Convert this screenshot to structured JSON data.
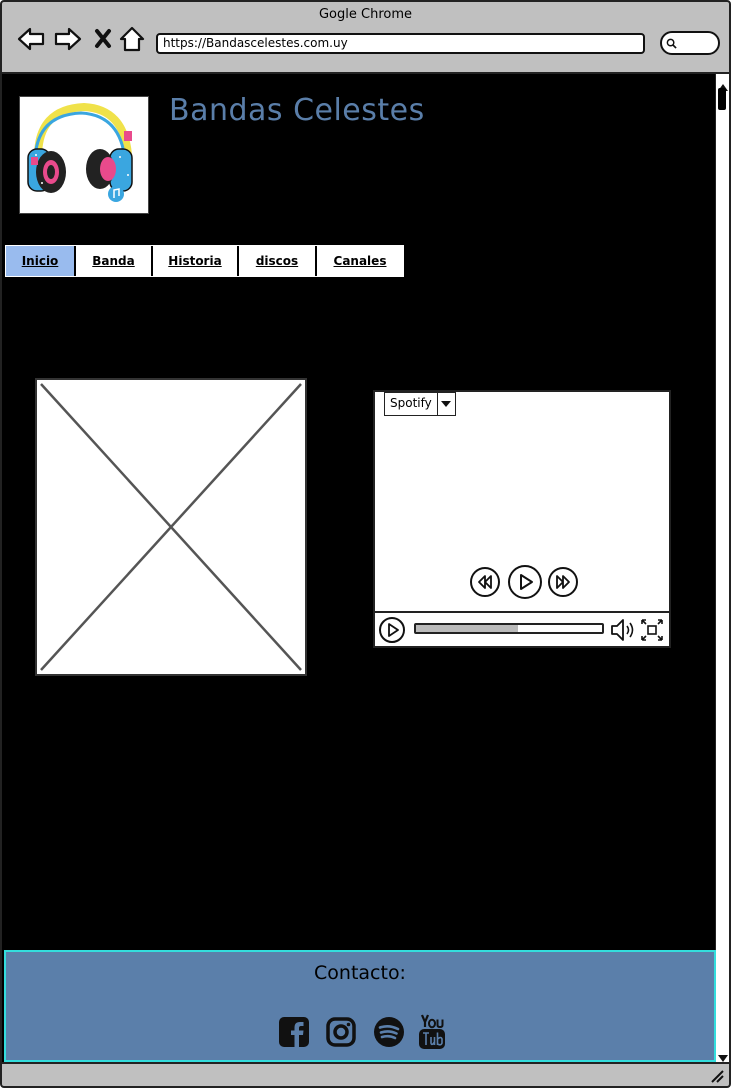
{
  "browser": {
    "window_title": "Gogle Chrome",
    "url": "https://Bandascelestes.com.uy"
  },
  "site": {
    "title": "Bandas Celestes"
  },
  "tabs": [
    {
      "label": "Inicio",
      "active": true
    },
    {
      "label": "Banda",
      "active": false
    },
    {
      "label": "Historia",
      "active": false
    },
    {
      "label": "discos",
      "active": false
    },
    {
      "label": "Canales",
      "active": false
    }
  ],
  "player": {
    "source_selected": "Spotify",
    "progress_fraction": 0.55
  },
  "footer": {
    "title": "Contacto:",
    "social_icons": [
      "facebook-icon",
      "instagram-icon",
      "spotify-icon",
      "youtube-icon"
    ]
  },
  "colors": {
    "title_blue": "#5a7ea9",
    "active_tab": "#99bbee",
    "footer_bg": "#5b7faa",
    "footer_border": "#33dddd",
    "chrome_gray": "#c0c0c0"
  }
}
